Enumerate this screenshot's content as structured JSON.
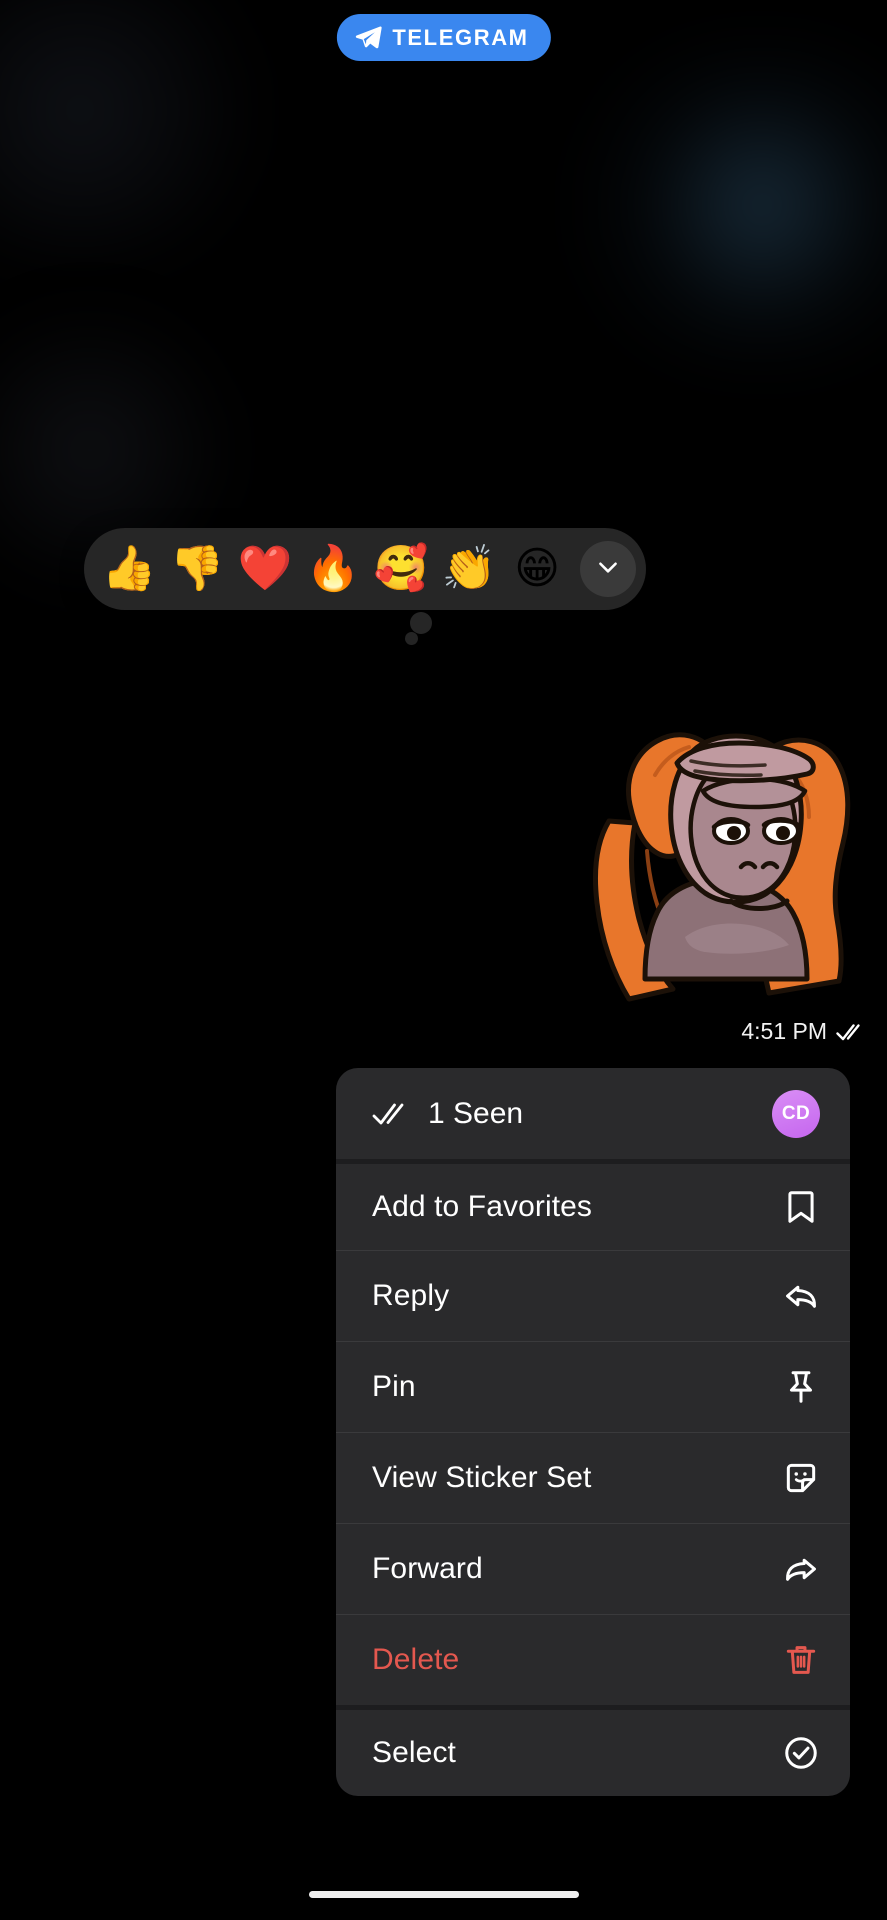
{
  "watermark": {
    "label": "TELEGRAM",
    "icon": "telegram-plane-icon",
    "bg_color": "#3a87ef"
  },
  "reaction_bar": {
    "reactions": [
      {
        "name": "thumbs-up",
        "emoji": "👍"
      },
      {
        "name": "thumbs-down",
        "emoji": "👎"
      },
      {
        "name": "red-heart",
        "emoji": "❤️"
      },
      {
        "name": "fire",
        "emoji": "🔥"
      },
      {
        "name": "smiling-face-with-hearts",
        "emoji": "🥰"
      },
      {
        "name": "clapping-hands",
        "emoji": "👏"
      },
      {
        "name": "grinning-face-with-smiling-eyes",
        "emoji": "😁"
      }
    ],
    "expand_icon": "chevron-down-icon"
  },
  "message": {
    "type": "sticker",
    "sticker_name": "orangutan-facepalm-sticker",
    "time": "4:51 PM",
    "status_icon": "double-check-icon"
  },
  "context_menu": {
    "seen_row": {
      "icon": "double-check-icon",
      "label": "1 Seen",
      "avatar_initials": "CD",
      "avatar_color": "#c566ef"
    },
    "items": [
      {
        "label": "Add to Favorites",
        "icon": "bookmark-icon",
        "destructive": false,
        "separated": false
      },
      {
        "label": "Reply",
        "icon": "reply-arrow-icon",
        "destructive": false,
        "separated": false
      },
      {
        "label": "Pin",
        "icon": "pushpin-icon",
        "destructive": false,
        "separated": false
      },
      {
        "label": "View Sticker Set",
        "icon": "sticker-icon",
        "destructive": false,
        "separated": false
      },
      {
        "label": "Forward",
        "icon": "forward-arrow-icon",
        "destructive": false,
        "separated": false
      },
      {
        "label": "Delete",
        "icon": "trash-icon",
        "destructive": true,
        "separated": false
      },
      {
        "label": "Select",
        "icon": "check-circle-icon",
        "destructive": false,
        "separated": true
      }
    ]
  },
  "colors": {
    "menu_bg": "#2a2a2c",
    "separator": "#3a3a3c",
    "destructive": "#e4584f",
    "reaction_bar_bg": "#262626",
    "background": "#000000"
  }
}
